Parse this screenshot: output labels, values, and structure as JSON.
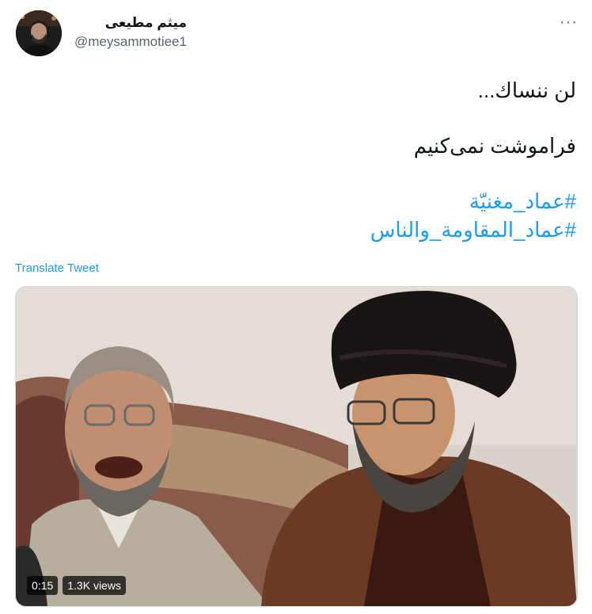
{
  "user": {
    "display_name": "میثم مطیعی",
    "handle": "@meysammotiee1"
  },
  "tweet": {
    "line1": "لن ننساك...",
    "line2": "فراموشت نمی‌کنیم",
    "hashtag1": "#عماد_مغنيّة",
    "hashtag2": "#عماد_المقاومة_والناس"
  },
  "translate_label": "Translate Tweet",
  "more_label": "···",
  "video": {
    "duration": "0:15",
    "views": "1.3K views"
  }
}
